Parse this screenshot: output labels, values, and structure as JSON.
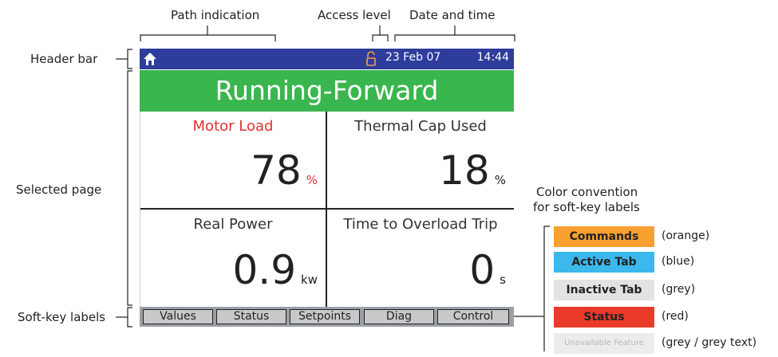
{
  "annotations": {
    "path_indication": "Path indication",
    "access_level": "Access level",
    "date_and_time": "Date and time",
    "header_bar": "Header bar",
    "selected_page": "Selected page",
    "soft_key_labels": "Soft-key labels",
    "color_convention_line1": "Color convention",
    "color_convention_line2": "for soft-key labels"
  },
  "screen": {
    "header": {
      "home_icon": "home-icon",
      "access_icon": "lock-icon",
      "date": "23 Feb 07",
      "time": "14:44"
    },
    "status_text": "Running-Forward",
    "cells": [
      {
        "title": "Motor Load",
        "value": "78",
        "unit": "%"
      },
      {
        "title": "Thermal Cap Used",
        "value": "18",
        "unit": "%"
      },
      {
        "title": "Real Power",
        "value": "0.9",
        "unit": "kw"
      },
      {
        "title": "Time to Overload Trip",
        "value": "0",
        "unit": "s"
      }
    ],
    "softkeys": [
      "Values",
      "Status",
      "Setpoints",
      "Diag",
      "Control"
    ]
  },
  "legend": [
    {
      "label": "Commands",
      "note": "(orange)",
      "bg": "#f7a030",
      "fg": "#222222"
    },
    {
      "label": "Active Tab",
      "note": "(blue)",
      "bg": "#3bb8ec",
      "fg": "#222222"
    },
    {
      "label": "Inactive Tab",
      "note": "(grey)",
      "bg": "#e3e3e3",
      "fg": "#222222"
    },
    {
      "label": "Status",
      "note": "(red)",
      "bg": "#ea3a2a",
      "fg": "#222222"
    },
    {
      "label": "Unavailable Feature",
      "note": "(grey / grey text)",
      "bg": "#ececec",
      "fg": "#b8b8b8"
    }
  ],
  "colors": {
    "header_bg": "#2e3c9c",
    "status_bg": "#3ab64e",
    "highlight_red": "#e03131"
  }
}
